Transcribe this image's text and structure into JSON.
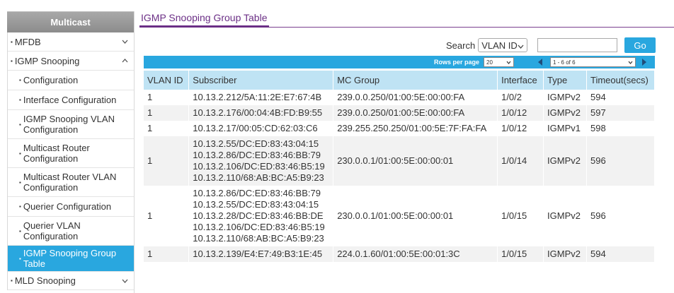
{
  "sidebar": {
    "title": "Multicast",
    "items": [
      {
        "label": "MFDB",
        "level": 1,
        "chevron": "down"
      },
      {
        "label": "IGMP Snooping",
        "level": 1,
        "chevron": "up"
      },
      {
        "label": "Configuration",
        "level": 2
      },
      {
        "label": "Interface Configuration",
        "level": 2
      },
      {
        "label": "IGMP Snooping VLAN Configuration",
        "level": 2
      },
      {
        "label": "Multicast Router Configuration",
        "level": 2
      },
      {
        "label": "Multicast Router VLAN Configuration",
        "level": 2
      },
      {
        "label": "Querier Configuration",
        "level": 2
      },
      {
        "label": "Querier VLAN Configuration",
        "level": 2
      },
      {
        "label": "IGMP Snooping Group Table",
        "level": 2,
        "active": true
      },
      {
        "label": "MLD Snooping",
        "level": 1,
        "chevron": "down"
      }
    ]
  },
  "tab": {
    "label": "IGMP Snooping Group Table"
  },
  "search": {
    "label": "Search",
    "selected": "VLAN ID",
    "value": "",
    "go_label": "Go"
  },
  "pager": {
    "rows_per_page_label": "Rows per page",
    "rows_per_page": "20",
    "range": "1 - 6 of 6"
  },
  "table": {
    "headers": [
      "VLAN ID",
      "Subscriber",
      "MC Group",
      "Interface",
      "Type",
      "Timeout(secs)"
    ],
    "rows": [
      {
        "vlan": "1",
        "subscribers": [
          "10.13.2.212/5A:11:2E:E7:67:4B"
        ],
        "mc_group": "239.0.0.250/01:00:5E:00:00:FA",
        "interface": "1/0/2",
        "type": "IGMPv2",
        "timeout": "594"
      },
      {
        "vlan": "1",
        "subscribers": [
          "10.13.2.176/00:04:4B:FD:B9:55"
        ],
        "mc_group": "239.0.0.250/01:00:5E:00:00:FA",
        "interface": "1/0/12",
        "type": "IGMPv2",
        "timeout": "597"
      },
      {
        "vlan": "1",
        "subscribers": [
          "10.13.2.17/00:05:CD:62:03:C6"
        ],
        "mc_group": "239.255.250.250/01:00:5E:7F:FA:FA",
        "interface": "1/0/12",
        "type": "IGMPv1",
        "timeout": "598"
      },
      {
        "vlan": "1",
        "subscribers": [
          "10.13.2.55/DC:ED:83:43:04:15",
          "10.13.2.86/DC:ED:83:46:BB:79",
          "10.13.2.106/DC:ED:83:46:B5:19",
          "10.13.2.110/68:AB:BC:A5:B9:23"
        ],
        "mc_group": "230.0.0.1/01:00:5E:00:00:01",
        "interface": "1/0/14",
        "type": "IGMPv2",
        "timeout": "596"
      },
      {
        "vlan": "1",
        "subscribers": [
          "10.13.2.86/DC:ED:83:46:BB:79",
          "10.13.2.55/DC:ED:83:43:04:15",
          "10.13.2.28/DC:ED:83:46:BB:DE",
          "10.13.2.106/DC:ED:83:46:B5:19",
          "10.13.2.110/68:AB:BC:A5:B9:23"
        ],
        "mc_group": "230.0.0.1/01:00:5E:00:00:01",
        "interface": "1/0/15",
        "type": "IGMPv2",
        "timeout": "596"
      },
      {
        "vlan": "1",
        "subscribers": [
          "10.13.2.139/E4:E7:49:B3:1E:45"
        ],
        "mc_group": "224.0.1.60/01:00:5E:00:01:3C",
        "interface": "1/0/15",
        "type": "IGMPv2",
        "timeout": "594"
      }
    ]
  },
  "colors": {
    "accent": "#29a7df",
    "tab": "#6b2f86",
    "header_bg": "#bfe3f4"
  }
}
